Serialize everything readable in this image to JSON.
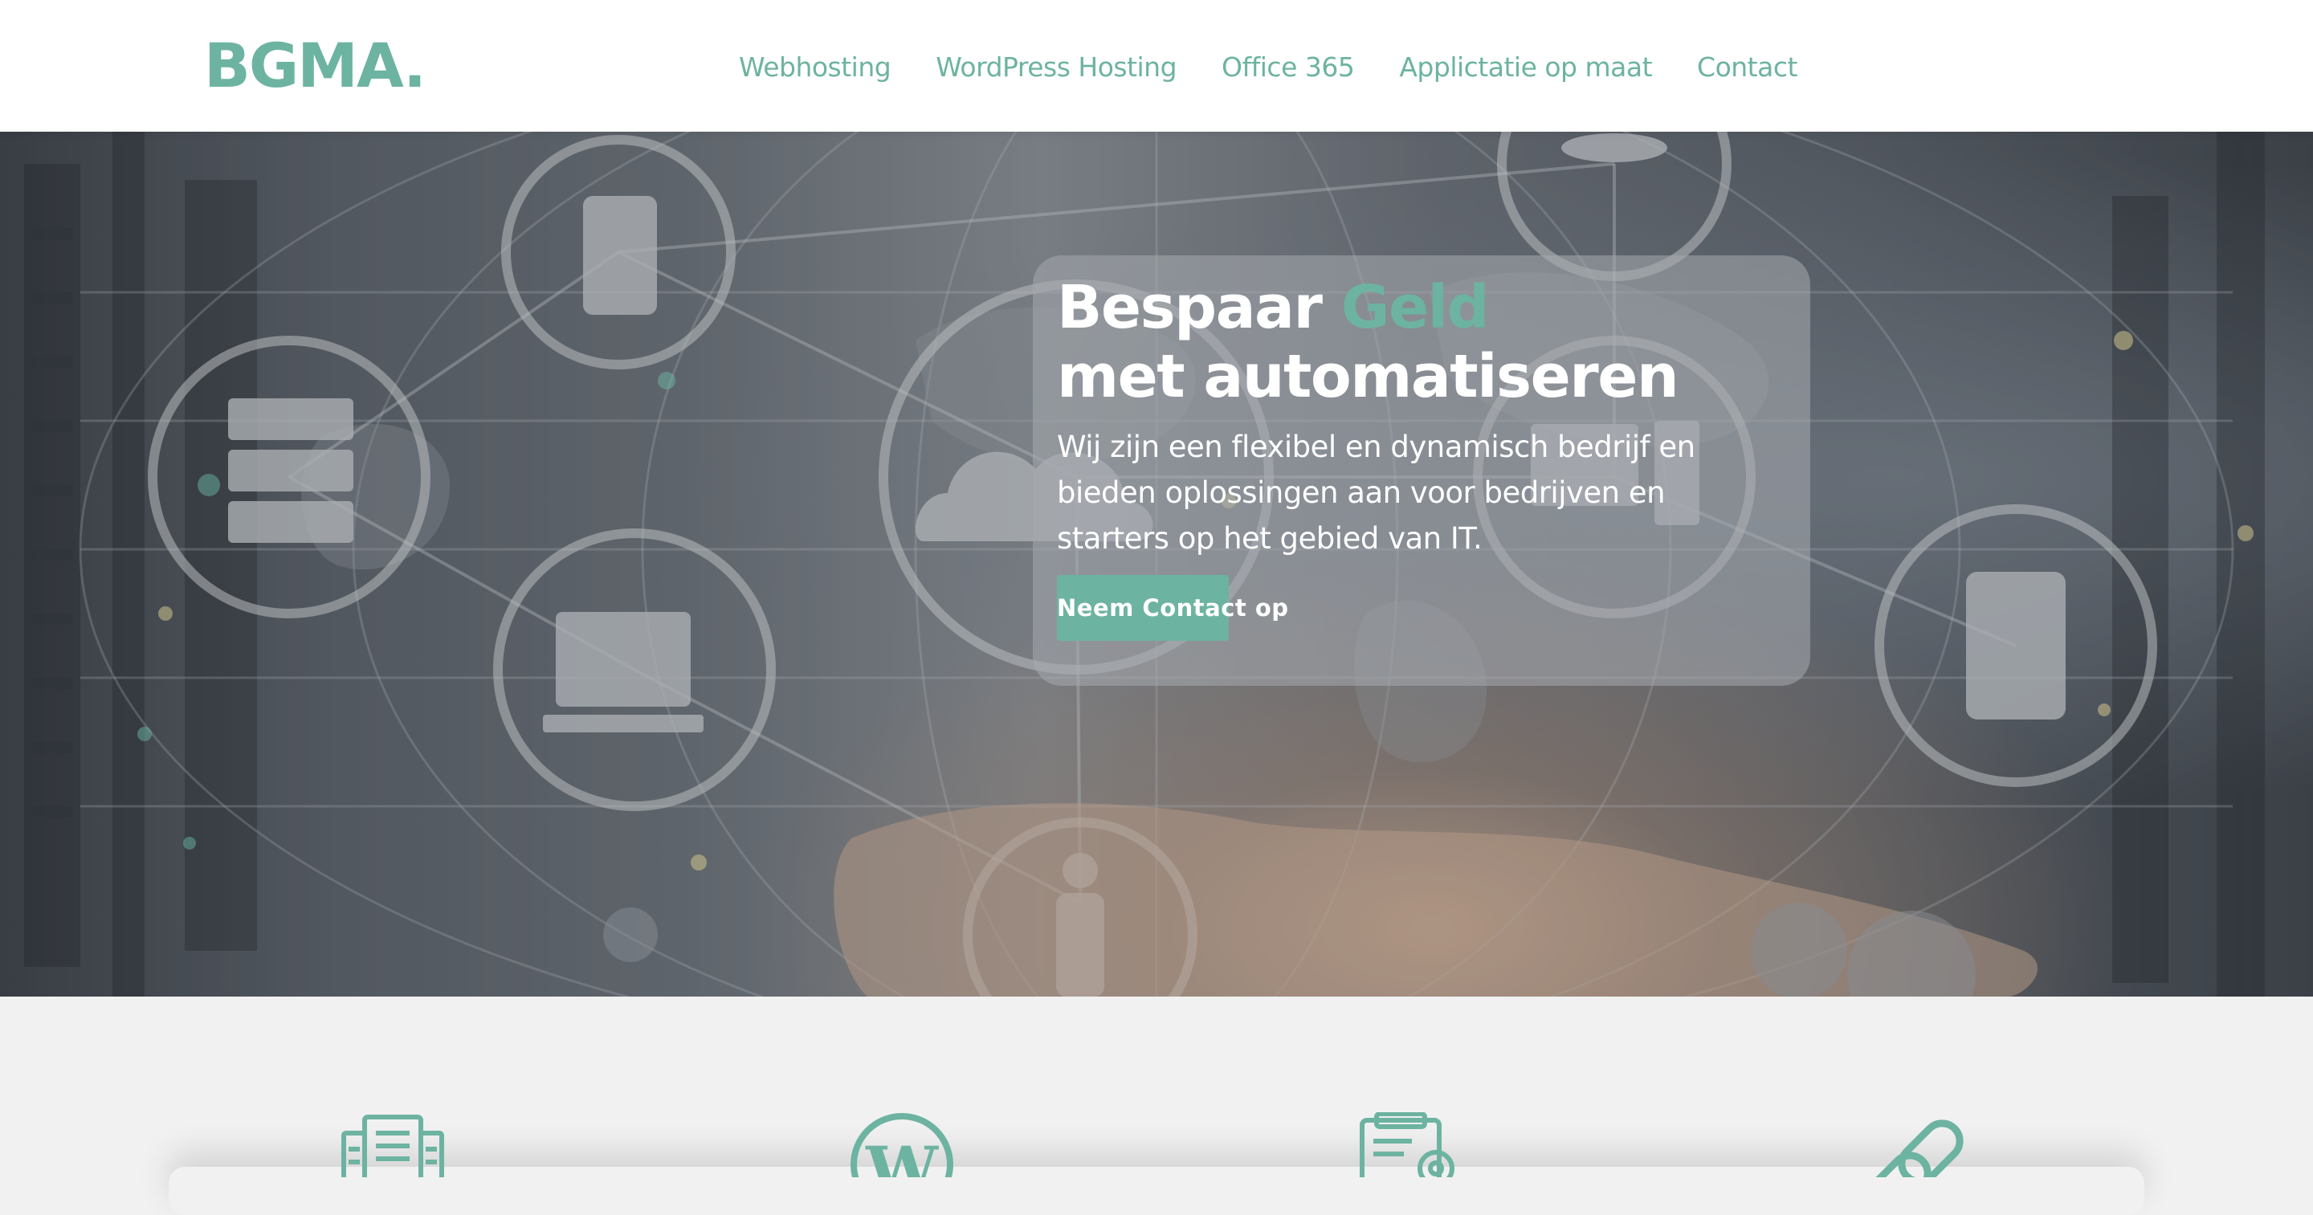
{
  "header": {
    "logo": "BGMA.",
    "nav": [
      "Webhosting",
      "WordPress Hosting",
      "Office 365",
      "Applictatie op maat",
      "Contact"
    ]
  },
  "hero": {
    "title_part1": "Bespaar ",
    "title_accent": "Geld",
    "title_line2": "met automatiseren",
    "text": "Wij zijn een flexibel en dynamisch bedrijf en bieden oplossingen aan voor bedrijven en starters op het gebied van IT.",
    "button": "Neem Contact op"
  },
  "services": {
    "icons": [
      "document-icon",
      "wordpress-icon",
      "settings-document-icon",
      "link-icon"
    ]
  },
  "colors": {
    "accent": "#6db3a1",
    "header_bg": "#ffffff",
    "page_bg": "#f1f1f1"
  }
}
